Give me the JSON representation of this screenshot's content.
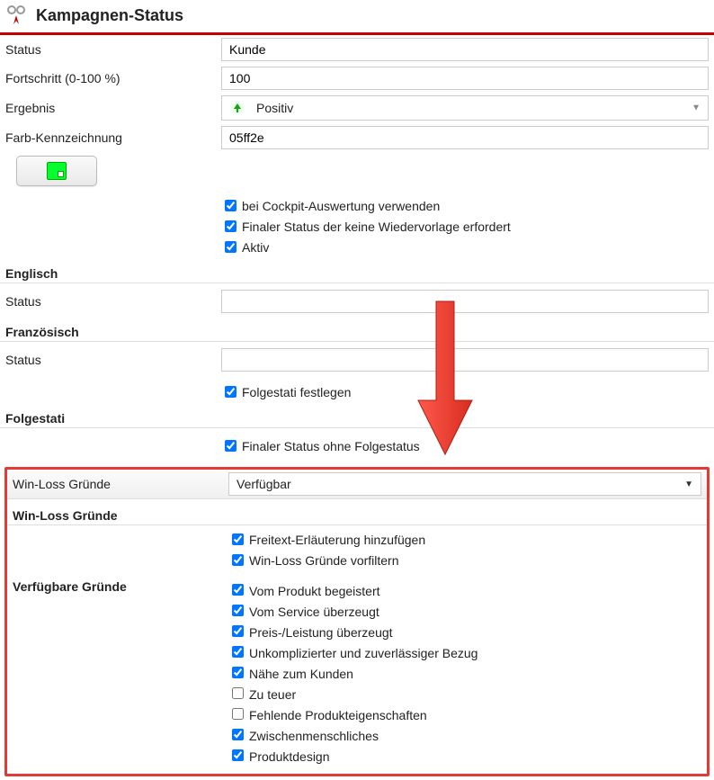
{
  "header": {
    "title": "Kampagnen-Status"
  },
  "fields": {
    "status_label": "Status",
    "status_value": "Kunde",
    "progress_label": "Fortschritt (0-100 %)",
    "progress_value": "100",
    "result_label": "Ergebnis",
    "result_value": "Positiv",
    "colorcode_label": "Farb-Kennzeichnung",
    "colorcode_value": "05ff2e",
    "chk_cockpit": "bei Cockpit-Auswertung verwenden",
    "chk_final_nowv": "Finaler Status der keine Wiedervorlage erfordert",
    "chk_active": "Aktiv"
  },
  "sections": {
    "english": "Englisch",
    "english_status_label": "Status",
    "english_status_value": "",
    "french": "Französisch",
    "french_status_label": "Status",
    "french_status_value": "",
    "chk_define_follow": "Folgestati festlegen",
    "followups": "Folgestati",
    "chk_final_no_follow": "Finaler Status ohne Folgestatus"
  },
  "winloss": {
    "dropdown_label": "Win-Loss Gründe",
    "dropdown_value": "Verfügbar",
    "section_title": "Win-Loss Gründe",
    "chk_freetext": "Freitext-Erläuterung hinzufügen",
    "chk_prefilter": "Win-Loss Gründe vorfiltern",
    "available_label": "Verfügbare Gründe",
    "reasons": [
      {
        "label": "Vom Produkt begeistert",
        "checked": true
      },
      {
        "label": "Vom Service überzeugt",
        "checked": true
      },
      {
        "label": "Preis-/Leistung überzeugt",
        "checked": true
      },
      {
        "label": "Unkomplizierter und zuverlässiger Bezug",
        "checked": true
      },
      {
        "label": "Nähe zum Kunden",
        "checked": true
      },
      {
        "label": "Zu teuer",
        "checked": false
      },
      {
        "label": "Fehlende Produkteigenschaften",
        "checked": false
      },
      {
        "label": "Zwischenmenschliches",
        "checked": true
      },
      {
        "label": "Produktdesign",
        "checked": true
      }
    ]
  }
}
